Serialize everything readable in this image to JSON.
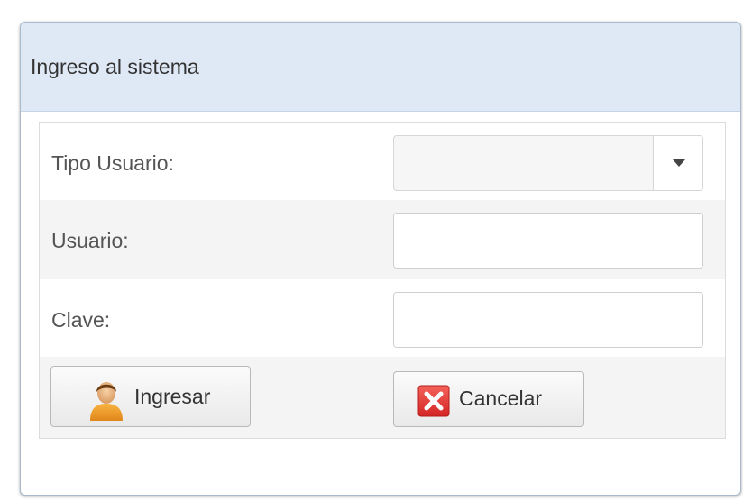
{
  "dialog": {
    "title": "Ingreso al sistema"
  },
  "form": {
    "tipo_usuario": {
      "label": "Tipo Usuario:",
      "selected": "",
      "icon": "chevron-down-icon"
    },
    "usuario": {
      "label": "Usuario:",
      "value": ""
    },
    "clave": {
      "label": "Clave:",
      "value": ""
    }
  },
  "buttons": {
    "ingresar": {
      "label": "Ingresar",
      "icon": "user-icon"
    },
    "cancelar": {
      "label": "Cancelar",
      "icon": "close-icon"
    }
  },
  "colors": {
    "titlebar_bg": "#dfe9f5",
    "row_alt_bg": "#f4f4f4",
    "cancel_icon_red": "#e8393a"
  }
}
